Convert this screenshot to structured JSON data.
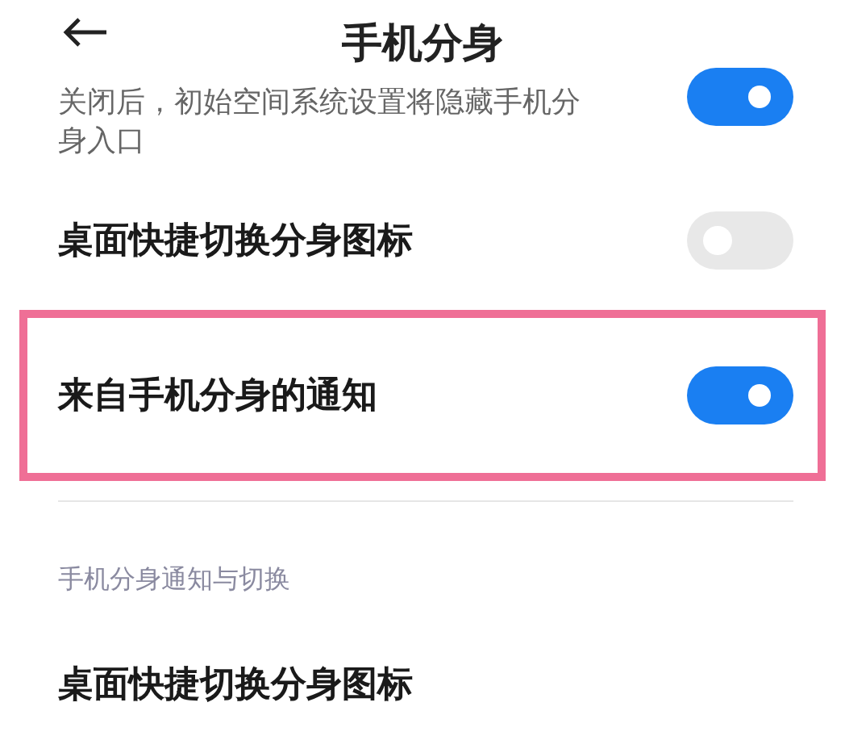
{
  "header": {
    "title": "手机分身"
  },
  "rows": [
    {
      "kind": "note",
      "label": "关闭后，初始空间系统设置将隐藏手机分身入口",
      "on": true,
      "highlighted": false
    },
    {
      "kind": "toggle",
      "label": "桌面快捷切换分身图标",
      "on": false,
      "highlighted": false
    },
    {
      "kind": "toggle",
      "label": "来自手机分身的通知",
      "on": true,
      "highlighted": true
    }
  ],
  "section": {
    "title": "手机分身通知与切换",
    "rows": [
      {
        "label": "桌面快捷切换分身图标"
      }
    ]
  }
}
